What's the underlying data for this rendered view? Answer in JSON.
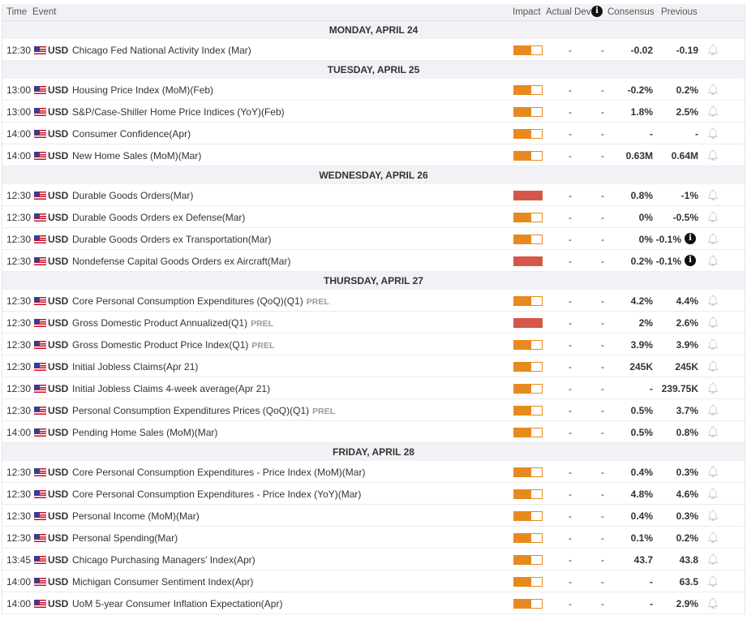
{
  "header": {
    "time": "Time",
    "event": "Event",
    "impact": "Impact",
    "actual": "Actual",
    "dev": "Dev",
    "info": "i",
    "consensus": "Consensus",
    "previous": "Previous"
  },
  "days": [
    {
      "label": "MONDAY, APRIL 24",
      "events": [
        {
          "time": "12:30",
          "currency": "USD",
          "name": "Chicago Fed National Activity Index (Mar)",
          "impact": "medium",
          "actual": "-",
          "dev": "-",
          "consensus": "-0.02",
          "previous": "-0.19"
        }
      ]
    },
    {
      "label": "TUESDAY, APRIL 25",
      "events": [
        {
          "time": "13:00",
          "currency": "USD",
          "name": "Housing Price Index (MoM)(Feb)",
          "impact": "medium",
          "actual": "-",
          "dev": "-",
          "consensus": "-0.2%",
          "previous": "0.2%"
        },
        {
          "time": "13:00",
          "currency": "USD",
          "name": "S&P/Case-Shiller Home Price Indices (YoY)(Feb)",
          "impact": "medium",
          "actual": "-",
          "dev": "-",
          "consensus": "1.8%",
          "previous": "2.5%"
        },
        {
          "time": "14:00",
          "currency": "USD",
          "name": "Consumer Confidence(Apr)",
          "impact": "medium",
          "actual": "-",
          "dev": "-",
          "consensus": "-",
          "previous": "-"
        },
        {
          "time": "14:00",
          "currency": "USD",
          "name": "New Home Sales (MoM)(Mar)",
          "impact": "medium",
          "actual": "-",
          "dev": "-",
          "consensus": "0.63M",
          "previous": "0.64M"
        }
      ]
    },
    {
      "label": "WEDNESDAY, APRIL 26",
      "events": [
        {
          "time": "12:30",
          "currency": "USD",
          "name": "Durable Goods Orders(Mar)",
          "impact": "high",
          "actual": "-",
          "dev": "-",
          "consensus": "0.8%",
          "previous": "-1%"
        },
        {
          "time": "12:30",
          "currency": "USD",
          "name": "Durable Goods Orders ex Defense(Mar)",
          "impact": "medium",
          "actual": "-",
          "dev": "-",
          "consensus": "0%",
          "previous": "-0.5%"
        },
        {
          "time": "12:30",
          "currency": "USD",
          "name": "Durable Goods Orders ex Transportation(Mar)",
          "impact": "medium",
          "actual": "-",
          "dev": "-",
          "consensus": "0%",
          "previous": "-0.1%",
          "info": "i"
        },
        {
          "time": "12:30",
          "currency": "USD",
          "name": "Nondefense Capital Goods Orders ex Aircraft(Mar)",
          "impact": "high",
          "actual": "-",
          "dev": "-",
          "consensus": "0.2%",
          "previous": "-0.1%",
          "info": "i"
        }
      ]
    },
    {
      "label": "THURSDAY, APRIL 27",
      "events": [
        {
          "time": "12:30",
          "currency": "USD",
          "name": "Core Personal Consumption Expenditures (QoQ)(Q1)",
          "tag": "PREL",
          "impact": "medium",
          "actual": "-",
          "dev": "-",
          "consensus": "4.2%",
          "previous": "4.4%"
        },
        {
          "time": "12:30",
          "currency": "USD",
          "name": "Gross Domestic Product Annualized(Q1)",
          "tag": "PREL",
          "impact": "high",
          "actual": "-",
          "dev": "-",
          "consensus": "2%",
          "previous": "2.6%"
        },
        {
          "time": "12:30",
          "currency": "USD",
          "name": "Gross Domestic Product Price Index(Q1)",
          "tag": "PREL",
          "impact": "medium",
          "actual": "-",
          "dev": "-",
          "consensus": "3.9%",
          "previous": "3.9%"
        },
        {
          "time": "12:30",
          "currency": "USD",
          "name": "Initial Jobless Claims(Apr 21)",
          "impact": "medium",
          "actual": "-",
          "dev": "-",
          "consensus": "245K",
          "previous": "245K"
        },
        {
          "time": "12:30",
          "currency": "USD",
          "name": "Initial Jobless Claims 4-week average(Apr 21)",
          "impact": "medium",
          "actual": "-",
          "dev": "-",
          "consensus": "-",
          "previous": "239.75K"
        },
        {
          "time": "12:30",
          "currency": "USD",
          "name": "Personal Consumption Expenditures Prices (QoQ)(Q1)",
          "tag": "PREL",
          "impact": "medium",
          "actual": "-",
          "dev": "-",
          "consensus": "0.5%",
          "previous": "3.7%"
        },
        {
          "time": "14:00",
          "currency": "USD",
          "name": "Pending Home Sales (MoM)(Mar)",
          "impact": "medium",
          "actual": "-",
          "dev": "-",
          "consensus": "0.5%",
          "previous": "0.8%"
        }
      ]
    },
    {
      "label": "FRIDAY, APRIL 28",
      "events": [
        {
          "time": "12:30",
          "currency": "USD",
          "name": "Core Personal Consumption Expenditures - Price Index (MoM)(Mar)",
          "impact": "medium",
          "actual": "-",
          "dev": "-",
          "consensus": "0.4%",
          "previous": "0.3%"
        },
        {
          "time": "12:30",
          "currency": "USD",
          "name": "Core Personal Consumption Expenditures - Price Index (YoY)(Mar)",
          "impact": "medium",
          "actual": "-",
          "dev": "-",
          "consensus": "4.8%",
          "previous": "4.6%"
        },
        {
          "time": "12:30",
          "currency": "USD",
          "name": "Personal Income (MoM)(Mar)",
          "impact": "medium",
          "actual": "-",
          "dev": "-",
          "consensus": "0.4%",
          "previous": "0.3%"
        },
        {
          "time": "12:30",
          "currency": "USD",
          "name": "Personal Spending(Mar)",
          "impact": "medium",
          "actual": "-",
          "dev": "-",
          "consensus": "0.1%",
          "previous": "0.2%"
        },
        {
          "time": "13:45",
          "currency": "USD",
          "name": "Chicago Purchasing Managers' Index(Apr)",
          "impact": "medium",
          "actual": "-",
          "dev": "-",
          "consensus": "43.7",
          "previous": "43.8"
        },
        {
          "time": "14:00",
          "currency": "USD",
          "name": "Michigan Consumer Sentiment Index(Apr)",
          "impact": "medium",
          "actual": "-",
          "dev": "-",
          "consensus": "-",
          "previous": "63.5"
        },
        {
          "time": "14:00",
          "currency": "USD",
          "name": "UoM 5-year Consumer Inflation Expectation(Apr)",
          "impact": "medium",
          "actual": "-",
          "dev": "-",
          "consensus": "-",
          "previous": "2.9%"
        }
      ]
    }
  ]
}
